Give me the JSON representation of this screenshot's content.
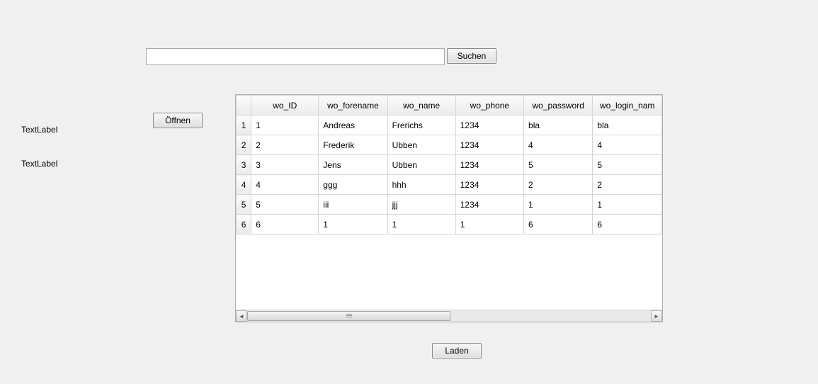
{
  "search": {
    "value": "",
    "button_label": "Suchen"
  },
  "open_button_label": "Öffnen",
  "load_button_label": "Laden",
  "labels": {
    "text1": "TextLabel",
    "text2": "TextLabel"
  },
  "table": {
    "columns": [
      "wo_ID",
      "wo_forename",
      "wo_name",
      "wo_phone",
      "wo_password",
      "wo_login_nam"
    ],
    "rows": [
      {
        "num": "1",
        "cells": [
          "1",
          "Andreas",
          "Frerichs",
          "1234",
          "bla",
          "bla"
        ]
      },
      {
        "num": "2",
        "cells": [
          "2",
          "Frederik",
          "Ubben",
          "1234",
          "4",
          "4"
        ]
      },
      {
        "num": "3",
        "cells": [
          "3",
          "Jens",
          "Ubben",
          "1234",
          "5",
          "5"
        ]
      },
      {
        "num": "4",
        "cells": [
          "4",
          "ggg",
          "hhh",
          "1234",
          "2",
          "2"
        ]
      },
      {
        "num": "5",
        "cells": [
          "5",
          "iii",
          "jjj",
          "1234",
          "1",
          "1"
        ]
      },
      {
        "num": "6",
        "cells": [
          "6",
          "1",
          "1",
          "1",
          "6",
          "6"
        ]
      }
    ]
  }
}
